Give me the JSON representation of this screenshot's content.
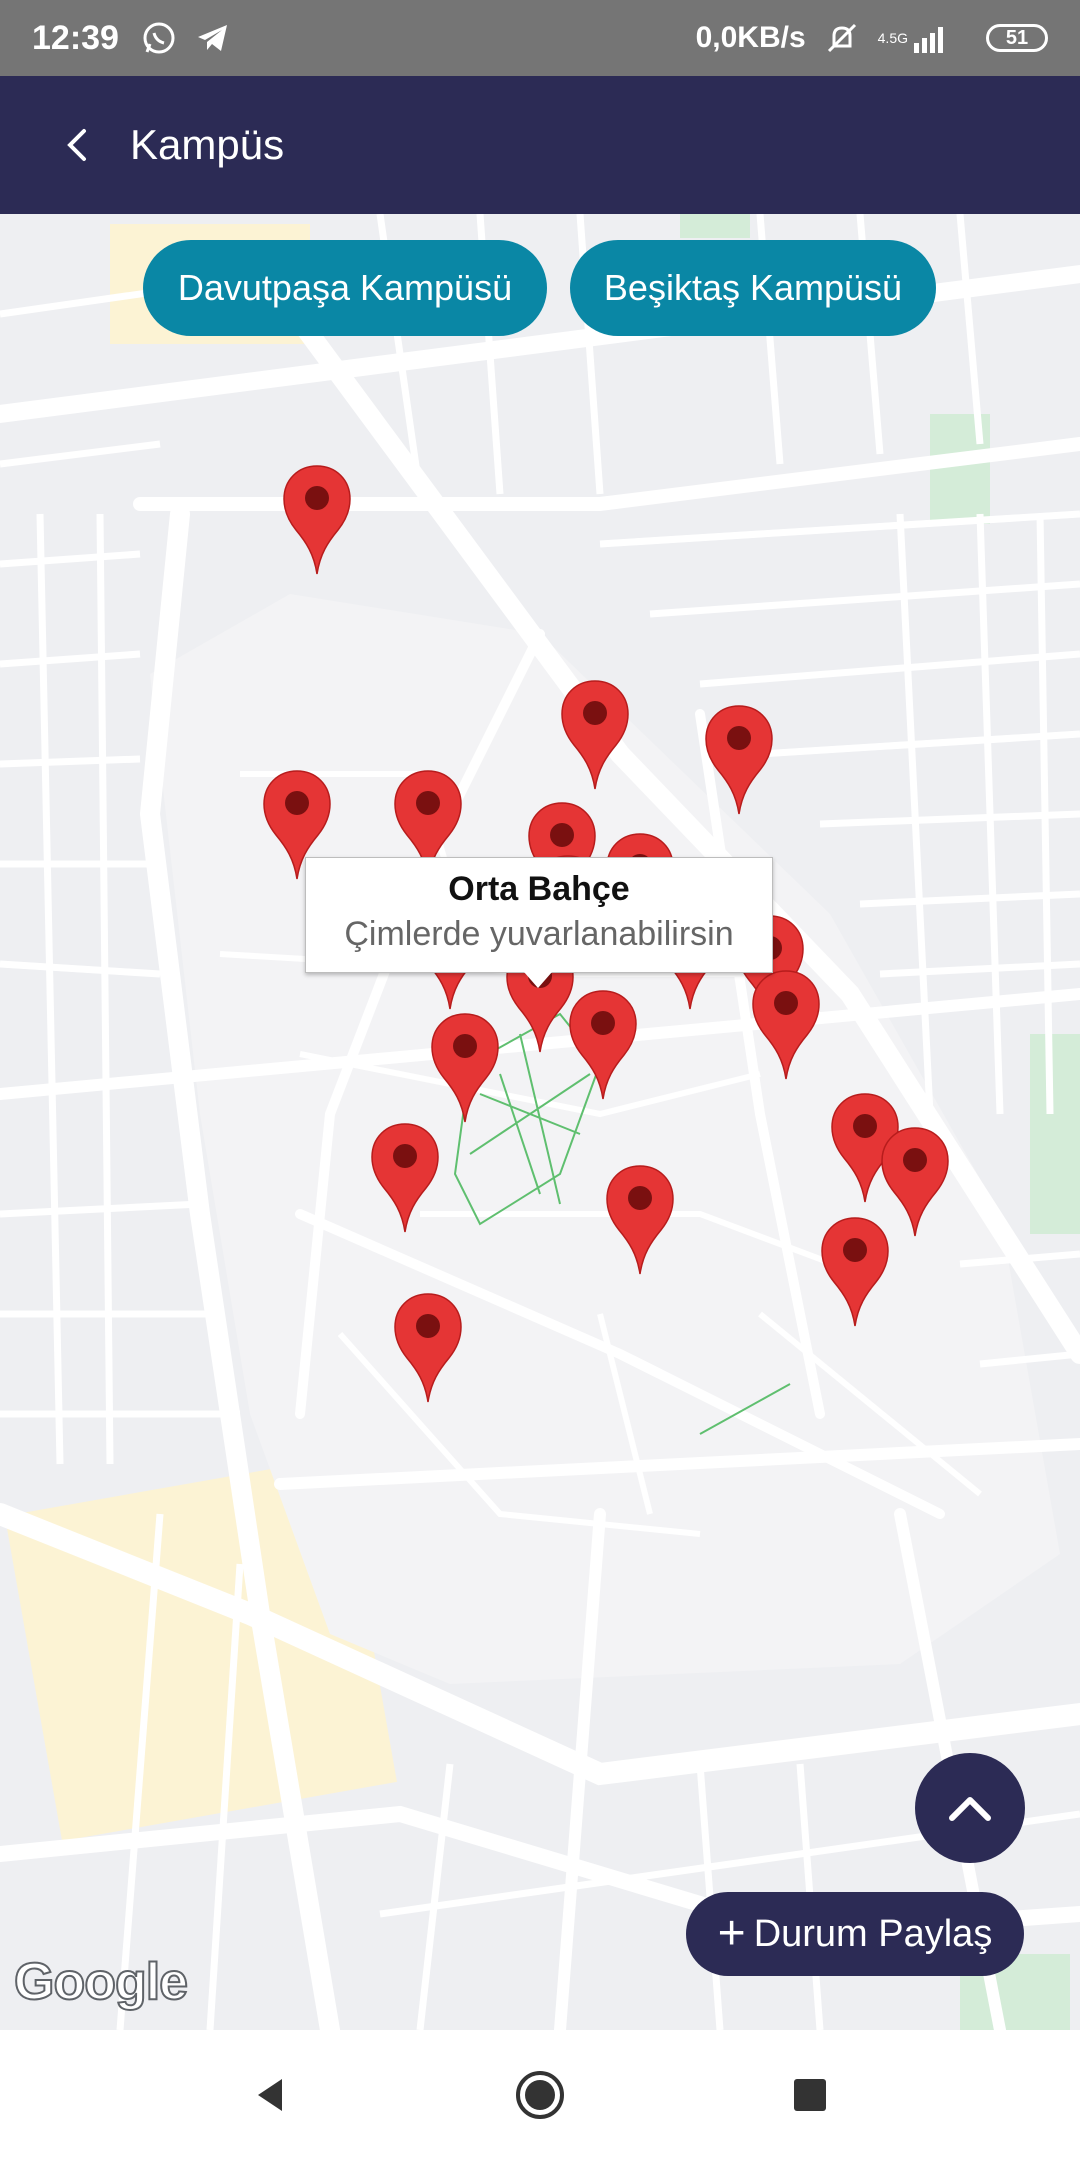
{
  "status_bar": {
    "time": "12:39",
    "net_speed": "0,0KB/s",
    "network_type": "4.5G",
    "battery": "51",
    "icons": [
      "whatsapp-icon",
      "telegram-icon",
      "vibrate-off-icon",
      "signal-icon",
      "battery-icon"
    ]
  },
  "app_bar": {
    "title": "Kampüs",
    "back_icon": "back-chevron-icon"
  },
  "campus_buttons": [
    {
      "label": "Davutpaşa Kampüsü"
    },
    {
      "label": "Beşiktaş Kampüsü"
    }
  ],
  "info_window": {
    "title": "Orta Bahçe",
    "subtitle": "Çimlerde yuvarlanabilirsin"
  },
  "map": {
    "marker_color": "#e53535",
    "markers": [
      "marker-1",
      "marker-2",
      "marker-3",
      "marker-4",
      "marker-5",
      "marker-6",
      "marker-7",
      "marker-8",
      "marker-9",
      "marker-10",
      "marker-11",
      "marker-12",
      "marker-13",
      "marker-14",
      "marker-15",
      "marker-16",
      "marker-17",
      "marker-18",
      "marker-19",
      "marker-20",
      "marker-21"
    ],
    "attribution": "Google"
  },
  "fab": {
    "icon": "chevron-up-icon"
  },
  "share_button": {
    "label": "Durum Paylaş",
    "icon": "plus-icon"
  },
  "colors": {
    "app_bar": "#2c2b55",
    "campus_button": "#0a87a5",
    "status_bar": "#757575"
  },
  "nav_bar": {
    "icons": [
      "back-triangle-icon",
      "home-circle-icon",
      "recents-square-icon"
    ]
  }
}
